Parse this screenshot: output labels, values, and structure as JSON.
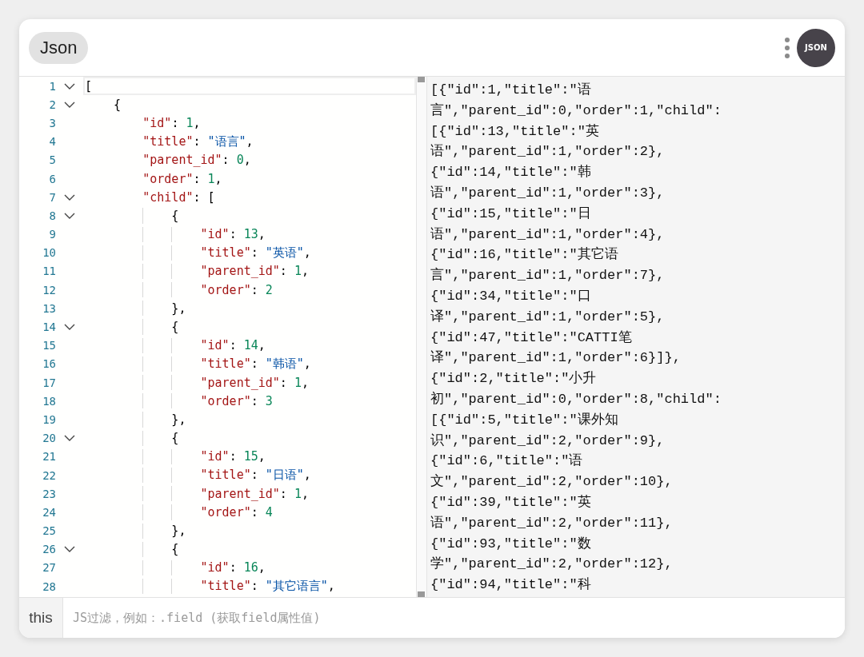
{
  "header": {
    "button": "Json",
    "logo": "JSON"
  },
  "editor": {
    "lines": [
      {
        "number": "1",
        "expanded": true,
        "active": true,
        "tokens": [
          {
            "kind": "punct",
            "text": "["
          }
        ]
      },
      {
        "number": "2",
        "expanded": true,
        "active": false,
        "tokens": [
          {
            "kind": "punct",
            "text": "    {"
          }
        ]
      },
      {
        "number": "3",
        "active": false,
        "tokens": [
          {
            "kind": "key",
            "text": "        \"id\""
          },
          {
            "kind": "punct",
            "text": ": "
          },
          {
            "kind": "number",
            "text": "1"
          },
          {
            "kind": "punct",
            "text": ","
          }
        ]
      },
      {
        "number": "4",
        "active": false,
        "tokens": [
          {
            "kind": "key",
            "text": "        \"title\""
          },
          {
            "kind": "punct",
            "text": ": "
          },
          {
            "kind": "string",
            "text": "\"语言\""
          },
          {
            "kind": "punct",
            "text": ","
          }
        ]
      },
      {
        "number": "5",
        "active": false,
        "tokens": [
          {
            "kind": "key",
            "text": "        \"parent_id\""
          },
          {
            "kind": "punct",
            "text": ": "
          },
          {
            "kind": "number",
            "text": "0"
          },
          {
            "kind": "punct",
            "text": ","
          }
        ]
      },
      {
        "number": "6",
        "active": false,
        "tokens": [
          {
            "kind": "key",
            "text": "        \"order\""
          },
          {
            "kind": "punct",
            "text": ": "
          },
          {
            "kind": "number",
            "text": "1"
          },
          {
            "kind": "punct",
            "text": ","
          }
        ]
      },
      {
        "number": "7",
        "expanded": true,
        "active": false,
        "tokens": [
          {
            "kind": "key",
            "text": "        \"child\""
          },
          {
            "kind": "punct",
            "text": ": ["
          }
        ]
      },
      {
        "number": "8",
        "expanded": true,
        "active": false,
        "tokens": [
          {
            "kind": "punct",
            "text": "            {"
          }
        ]
      },
      {
        "number": "9",
        "active": false,
        "tokens": [
          {
            "kind": "key",
            "text": "                \"id\""
          },
          {
            "kind": "punct",
            "text": ": "
          },
          {
            "kind": "number",
            "text": "13"
          },
          {
            "kind": "punct",
            "text": ","
          }
        ]
      },
      {
        "number": "10",
        "active": false,
        "tokens": [
          {
            "kind": "key",
            "text": "                \"title\""
          },
          {
            "kind": "punct",
            "text": ": "
          },
          {
            "kind": "string",
            "text": "\"英语\""
          },
          {
            "kind": "punct",
            "text": ","
          }
        ]
      },
      {
        "number": "11",
        "active": false,
        "tokens": [
          {
            "kind": "key",
            "text": "                \"parent_id\""
          },
          {
            "kind": "punct",
            "text": ": "
          },
          {
            "kind": "number",
            "text": "1"
          },
          {
            "kind": "punct",
            "text": ","
          }
        ]
      },
      {
        "number": "12",
        "active": false,
        "tokens": [
          {
            "kind": "key",
            "text": "                \"order\""
          },
          {
            "kind": "punct",
            "text": ": "
          },
          {
            "kind": "number",
            "text": "2"
          }
        ]
      },
      {
        "number": "13",
        "active": false,
        "tokens": [
          {
            "kind": "punct",
            "text": "            },"
          }
        ]
      },
      {
        "number": "14",
        "expanded": true,
        "active": false,
        "tokens": [
          {
            "kind": "punct",
            "text": "            {"
          }
        ]
      },
      {
        "number": "15",
        "active": false,
        "tokens": [
          {
            "kind": "key",
            "text": "                \"id\""
          },
          {
            "kind": "punct",
            "text": ": "
          },
          {
            "kind": "number",
            "text": "14"
          },
          {
            "kind": "punct",
            "text": ","
          }
        ]
      },
      {
        "number": "16",
        "active": false,
        "tokens": [
          {
            "kind": "key",
            "text": "                \"title\""
          },
          {
            "kind": "punct",
            "text": ": "
          },
          {
            "kind": "string",
            "text": "\"韩语\""
          },
          {
            "kind": "punct",
            "text": ","
          }
        ]
      },
      {
        "number": "17",
        "active": false,
        "tokens": [
          {
            "kind": "key",
            "text": "                \"parent_id\""
          },
          {
            "kind": "punct",
            "text": ": "
          },
          {
            "kind": "number",
            "text": "1"
          },
          {
            "kind": "punct",
            "text": ","
          }
        ]
      },
      {
        "number": "18",
        "active": false,
        "tokens": [
          {
            "kind": "key",
            "text": "                \"order\""
          },
          {
            "kind": "punct",
            "text": ": "
          },
          {
            "kind": "number",
            "text": "3"
          }
        ]
      },
      {
        "number": "19",
        "active": false,
        "tokens": [
          {
            "kind": "punct",
            "text": "            },"
          }
        ]
      },
      {
        "number": "20",
        "expanded": true,
        "active": false,
        "tokens": [
          {
            "kind": "punct",
            "text": "            {"
          }
        ]
      },
      {
        "number": "21",
        "active": false,
        "tokens": [
          {
            "kind": "key",
            "text": "                \"id\""
          },
          {
            "kind": "punct",
            "text": ": "
          },
          {
            "kind": "number",
            "text": "15"
          },
          {
            "kind": "punct",
            "text": ","
          }
        ]
      },
      {
        "number": "22",
        "active": false,
        "tokens": [
          {
            "kind": "key",
            "text": "                \"title\""
          },
          {
            "kind": "punct",
            "text": ": "
          },
          {
            "kind": "string",
            "text": "\"日语\""
          },
          {
            "kind": "punct",
            "text": ","
          }
        ]
      },
      {
        "number": "23",
        "active": false,
        "tokens": [
          {
            "kind": "key",
            "text": "                \"parent_id\""
          },
          {
            "kind": "punct",
            "text": ": "
          },
          {
            "kind": "number",
            "text": "1"
          },
          {
            "kind": "punct",
            "text": ","
          }
        ]
      },
      {
        "number": "24",
        "active": false,
        "tokens": [
          {
            "kind": "key",
            "text": "                \"order\""
          },
          {
            "kind": "punct",
            "text": ": "
          },
          {
            "kind": "number",
            "text": "4"
          }
        ]
      },
      {
        "number": "25",
        "active": false,
        "tokens": [
          {
            "kind": "punct",
            "text": "            },"
          }
        ]
      },
      {
        "number": "26",
        "expanded": true,
        "active": false,
        "tokens": [
          {
            "kind": "punct",
            "text": "            {"
          }
        ]
      },
      {
        "number": "27",
        "active": false,
        "tokens": [
          {
            "kind": "key",
            "text": "                \"id\""
          },
          {
            "kind": "punct",
            "text": ": "
          },
          {
            "kind": "number",
            "text": "16"
          },
          {
            "kind": "punct",
            "text": ","
          }
        ]
      },
      {
        "number": "28",
        "active": false,
        "tokens": [
          {
            "kind": "key",
            "text": "                \"title\""
          },
          {
            "kind": "punct",
            "text": ": "
          },
          {
            "kind": "string",
            "text": "\"其它语言\""
          },
          {
            "kind": "punct",
            "text": ","
          }
        ]
      }
    ]
  },
  "output": {
    "lines": [
      "[{\"id\":1,\"title\":\"语",
      "言\",\"parent_id\":0,\"order\":1,\"child\":",
      "[{\"id\":13,\"title\":\"英",
      "语\",\"parent_id\":1,\"order\":2},",
      "{\"id\":14,\"title\":\"韩",
      "语\",\"parent_id\":1,\"order\":3},",
      "{\"id\":15,\"title\":\"日",
      "语\",\"parent_id\":1,\"order\":4},",
      "{\"id\":16,\"title\":\"其它语",
      "言\",\"parent_id\":1,\"order\":7},",
      "{\"id\":34,\"title\":\"口",
      "译\",\"parent_id\":1,\"order\":5},",
      "{\"id\":47,\"title\":\"CATTI笔",
      "译\",\"parent_id\":1,\"order\":6}]},",
      "{\"id\":2,\"title\":\"小升",
      "初\",\"parent_id\":0,\"order\":8,\"child\":",
      "[{\"id\":5,\"title\":\"课外知",
      "识\",\"parent_id\":2,\"order\":9},",
      "{\"id\":6,\"title\":\"语",
      "文\",\"parent_id\":2,\"order\":10},",
      "{\"id\":39,\"title\":\"英",
      "语\",\"parent_id\":2,\"order\":11},",
      "{\"id\":93,\"title\":\"数",
      "学\",\"parent_id\":2,\"order\":12},",
      "{\"id\":94,\"title\":\"科"
    ]
  },
  "footer": {
    "label": "this",
    "filter": {
      "placeholder": "JS过滤，例如：.field (获取field属性值)"
    }
  }
}
